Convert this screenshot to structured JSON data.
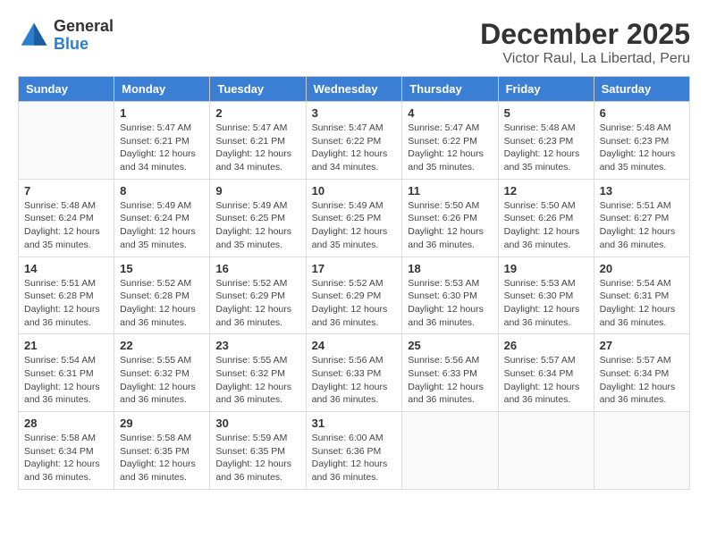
{
  "header": {
    "logo_general": "General",
    "logo_blue": "Blue",
    "month_title": "December 2025",
    "location": "Victor Raul, La Libertad, Peru"
  },
  "days_of_week": [
    "Sunday",
    "Monday",
    "Tuesday",
    "Wednesday",
    "Thursday",
    "Friday",
    "Saturday"
  ],
  "weeks": [
    [
      {
        "day": "",
        "sunrise": "",
        "sunset": "",
        "daylight": ""
      },
      {
        "day": "1",
        "sunrise": "Sunrise: 5:47 AM",
        "sunset": "Sunset: 6:21 PM",
        "daylight": "Daylight: 12 hours and 34 minutes."
      },
      {
        "day": "2",
        "sunrise": "Sunrise: 5:47 AM",
        "sunset": "Sunset: 6:21 PM",
        "daylight": "Daylight: 12 hours and 34 minutes."
      },
      {
        "day": "3",
        "sunrise": "Sunrise: 5:47 AM",
        "sunset": "Sunset: 6:22 PM",
        "daylight": "Daylight: 12 hours and 34 minutes."
      },
      {
        "day": "4",
        "sunrise": "Sunrise: 5:47 AM",
        "sunset": "Sunset: 6:22 PM",
        "daylight": "Daylight: 12 hours and 35 minutes."
      },
      {
        "day": "5",
        "sunrise": "Sunrise: 5:48 AM",
        "sunset": "Sunset: 6:23 PM",
        "daylight": "Daylight: 12 hours and 35 minutes."
      },
      {
        "day": "6",
        "sunrise": "Sunrise: 5:48 AM",
        "sunset": "Sunset: 6:23 PM",
        "daylight": "Daylight: 12 hours and 35 minutes."
      }
    ],
    [
      {
        "day": "7",
        "sunrise": "Sunrise: 5:48 AM",
        "sunset": "Sunset: 6:24 PM",
        "daylight": "Daylight: 12 hours and 35 minutes."
      },
      {
        "day": "8",
        "sunrise": "Sunrise: 5:49 AM",
        "sunset": "Sunset: 6:24 PM",
        "daylight": "Daylight: 12 hours and 35 minutes."
      },
      {
        "day": "9",
        "sunrise": "Sunrise: 5:49 AM",
        "sunset": "Sunset: 6:25 PM",
        "daylight": "Daylight: 12 hours and 35 minutes."
      },
      {
        "day": "10",
        "sunrise": "Sunrise: 5:49 AM",
        "sunset": "Sunset: 6:25 PM",
        "daylight": "Daylight: 12 hours and 35 minutes."
      },
      {
        "day": "11",
        "sunrise": "Sunrise: 5:50 AM",
        "sunset": "Sunset: 6:26 PM",
        "daylight": "Daylight: 12 hours and 36 minutes."
      },
      {
        "day": "12",
        "sunrise": "Sunrise: 5:50 AM",
        "sunset": "Sunset: 6:26 PM",
        "daylight": "Daylight: 12 hours and 36 minutes."
      },
      {
        "day": "13",
        "sunrise": "Sunrise: 5:51 AM",
        "sunset": "Sunset: 6:27 PM",
        "daylight": "Daylight: 12 hours and 36 minutes."
      }
    ],
    [
      {
        "day": "14",
        "sunrise": "Sunrise: 5:51 AM",
        "sunset": "Sunset: 6:28 PM",
        "daylight": "Daylight: 12 hours and 36 minutes."
      },
      {
        "day": "15",
        "sunrise": "Sunrise: 5:52 AM",
        "sunset": "Sunset: 6:28 PM",
        "daylight": "Daylight: 12 hours and 36 minutes."
      },
      {
        "day": "16",
        "sunrise": "Sunrise: 5:52 AM",
        "sunset": "Sunset: 6:29 PM",
        "daylight": "Daylight: 12 hours and 36 minutes."
      },
      {
        "day": "17",
        "sunrise": "Sunrise: 5:52 AM",
        "sunset": "Sunset: 6:29 PM",
        "daylight": "Daylight: 12 hours and 36 minutes."
      },
      {
        "day": "18",
        "sunrise": "Sunrise: 5:53 AM",
        "sunset": "Sunset: 6:30 PM",
        "daylight": "Daylight: 12 hours and 36 minutes."
      },
      {
        "day": "19",
        "sunrise": "Sunrise: 5:53 AM",
        "sunset": "Sunset: 6:30 PM",
        "daylight": "Daylight: 12 hours and 36 minutes."
      },
      {
        "day": "20",
        "sunrise": "Sunrise: 5:54 AM",
        "sunset": "Sunset: 6:31 PM",
        "daylight": "Daylight: 12 hours and 36 minutes."
      }
    ],
    [
      {
        "day": "21",
        "sunrise": "Sunrise: 5:54 AM",
        "sunset": "Sunset: 6:31 PM",
        "daylight": "Daylight: 12 hours and 36 minutes."
      },
      {
        "day": "22",
        "sunrise": "Sunrise: 5:55 AM",
        "sunset": "Sunset: 6:32 PM",
        "daylight": "Daylight: 12 hours and 36 minutes."
      },
      {
        "day": "23",
        "sunrise": "Sunrise: 5:55 AM",
        "sunset": "Sunset: 6:32 PM",
        "daylight": "Daylight: 12 hours and 36 minutes."
      },
      {
        "day": "24",
        "sunrise": "Sunrise: 5:56 AM",
        "sunset": "Sunset: 6:33 PM",
        "daylight": "Daylight: 12 hours and 36 minutes."
      },
      {
        "day": "25",
        "sunrise": "Sunrise: 5:56 AM",
        "sunset": "Sunset: 6:33 PM",
        "daylight": "Daylight: 12 hours and 36 minutes."
      },
      {
        "day": "26",
        "sunrise": "Sunrise: 5:57 AM",
        "sunset": "Sunset: 6:34 PM",
        "daylight": "Daylight: 12 hours and 36 minutes."
      },
      {
        "day": "27",
        "sunrise": "Sunrise: 5:57 AM",
        "sunset": "Sunset: 6:34 PM",
        "daylight": "Daylight: 12 hours and 36 minutes."
      }
    ],
    [
      {
        "day": "28",
        "sunrise": "Sunrise: 5:58 AM",
        "sunset": "Sunset: 6:34 PM",
        "daylight": "Daylight: 12 hours and 36 minutes."
      },
      {
        "day": "29",
        "sunrise": "Sunrise: 5:58 AM",
        "sunset": "Sunset: 6:35 PM",
        "daylight": "Daylight: 12 hours and 36 minutes."
      },
      {
        "day": "30",
        "sunrise": "Sunrise: 5:59 AM",
        "sunset": "Sunset: 6:35 PM",
        "daylight": "Daylight: 12 hours and 36 minutes."
      },
      {
        "day": "31",
        "sunrise": "Sunrise: 6:00 AM",
        "sunset": "Sunset: 6:36 PM",
        "daylight": "Daylight: 12 hours and 36 minutes."
      },
      {
        "day": "",
        "sunrise": "",
        "sunset": "",
        "daylight": ""
      },
      {
        "day": "",
        "sunrise": "",
        "sunset": "",
        "daylight": ""
      },
      {
        "day": "",
        "sunrise": "",
        "sunset": "",
        "daylight": ""
      }
    ]
  ]
}
